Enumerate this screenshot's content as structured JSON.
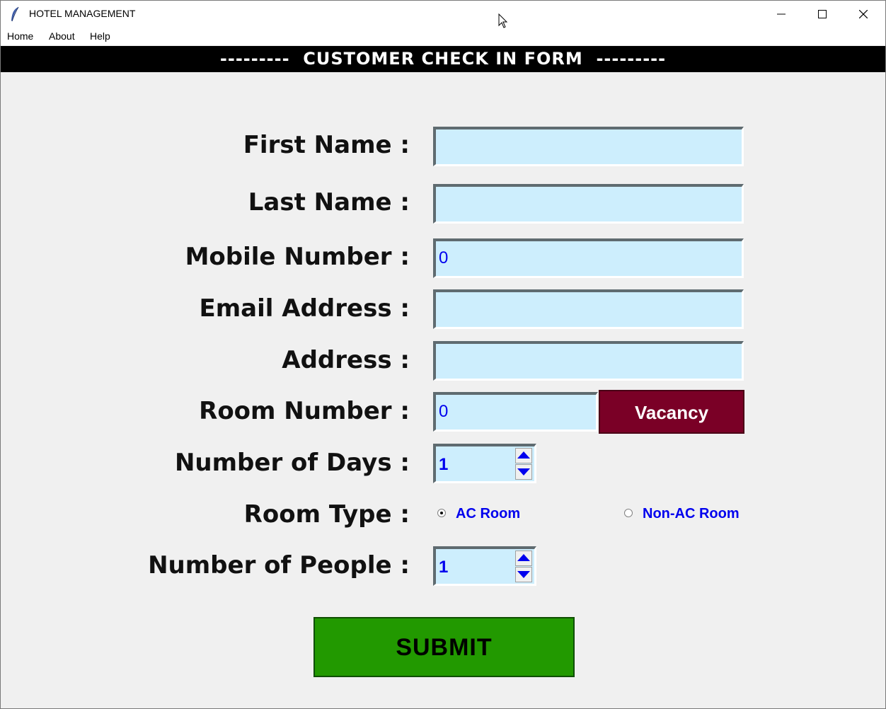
{
  "window": {
    "title": "HOTEL MANAGEMENT"
  },
  "menu": {
    "items": [
      "Home",
      "About",
      "Help"
    ]
  },
  "header": {
    "text": "---------  CUSTOMER CHECK IN FORM  ---------"
  },
  "form": {
    "first_name": {
      "label": "First Name :",
      "value": ""
    },
    "last_name": {
      "label": "Last Name :",
      "value": ""
    },
    "mobile": {
      "label": "Mobile Number :",
      "value": "0"
    },
    "email": {
      "label": "Email Address :",
      "value": ""
    },
    "address": {
      "label": "Address :",
      "value": ""
    },
    "room_number": {
      "label": "Room Number :",
      "value": "0",
      "button": "Vacancy"
    },
    "days": {
      "label": "Number of Days :",
      "value": "1"
    },
    "room_type": {
      "label": "Room Type :",
      "options": [
        "AC Room",
        "Non-AC Room"
      ],
      "selected": "AC Room"
    },
    "people": {
      "label": "Number of People :",
      "value": "1"
    },
    "submit": "SUBMIT"
  },
  "colors": {
    "entry_bg": "#cdeefd",
    "value_text": "#0000ee",
    "vacancy_bg": "#7a0026",
    "submit_bg": "#229900",
    "header_bg": "#000000"
  }
}
